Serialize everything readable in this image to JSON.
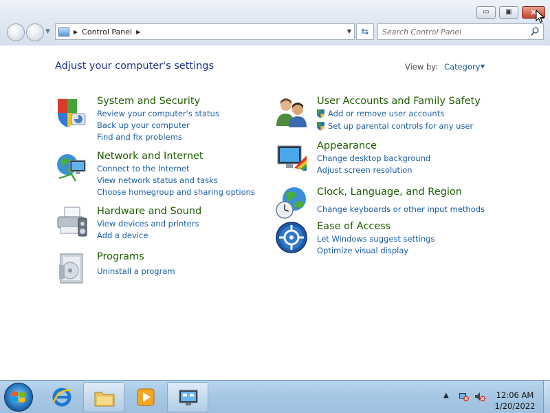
{
  "window": {
    "minimize_glyph": "▭",
    "maximize_glyph": "▣",
    "close_glyph": "✕"
  },
  "address_bar": {
    "icon": "control-panel-icon",
    "crumbs": [
      "Control Panel"
    ]
  },
  "search": {
    "placeholder": "Search Control Panel"
  },
  "page_title": "Adjust your computer's settings",
  "view_by": {
    "label": "View by:",
    "value": "Category"
  },
  "categories": [
    {
      "icon": "system-security-icon",
      "title": "System and Security",
      "links": [
        "Review your computer's status",
        "Back up your computer",
        "Find and fix problems"
      ]
    },
    {
      "icon": "network-internet-icon",
      "title": "Network and Internet",
      "links": [
        "Connect to the Internet",
        "View network status and tasks",
        "Choose homegroup and sharing options"
      ]
    },
    {
      "icon": "hardware-sound-icon",
      "title": "Hardware and Sound",
      "links": [
        "View devices and printers",
        "Add a device"
      ]
    },
    {
      "icon": "programs-icon",
      "title": "Programs",
      "links": [
        "Uninstall a program"
      ]
    },
    {
      "icon": "user-accounts-icon",
      "title": "User Accounts and Family Safety",
      "links": [
        "Add or remove user accounts",
        "Set up parental controls for any user"
      ]
    },
    {
      "icon": "appearance-icon",
      "title": "Appearance",
      "links": [
        "Change desktop background",
        "Adjust screen resolution"
      ]
    },
    {
      "icon": "clock-language-region-icon",
      "title": "Clock, Language, and Region",
      "links": [
        "Change keyboards or other input methods"
      ]
    },
    {
      "icon": "ease-of-access-icon",
      "title": "Ease of Access",
      "links": [
        "Let Windows suggest settings",
        "Optimize visual display"
      ]
    }
  ],
  "taskbar": {
    "pinned": [
      "internet-explorer-icon",
      "windows-explorer-icon",
      "media-player-icon",
      "control-panel-icon"
    ],
    "clock": {
      "time": "12:06 AM",
      "date": "1/20/2022"
    }
  }
}
